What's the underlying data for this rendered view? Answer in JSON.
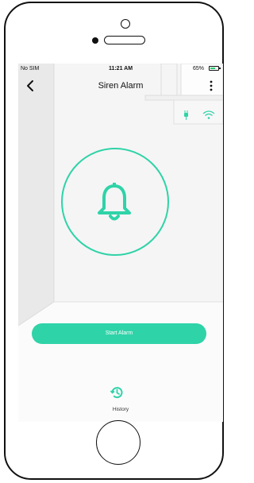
{
  "status_bar": {
    "carrier": "No SIM",
    "time": "11:21 AM",
    "battery_percent": "65%",
    "battery_level": 0.65
  },
  "nav": {
    "title": "Siren Alarm",
    "back_icon": "chevron-left-icon",
    "menu_icon": "more-vertical-icon"
  },
  "device_status": {
    "power_icon": "plug-icon",
    "wifi_icon": "wifi-icon"
  },
  "alarm": {
    "icon": "bell-icon",
    "button_label": "Start Alarm"
  },
  "history": {
    "label": "History",
    "icon": "history-icon"
  },
  "colors": {
    "accent": "#2fd3a8",
    "background": "#f5f5f5"
  }
}
